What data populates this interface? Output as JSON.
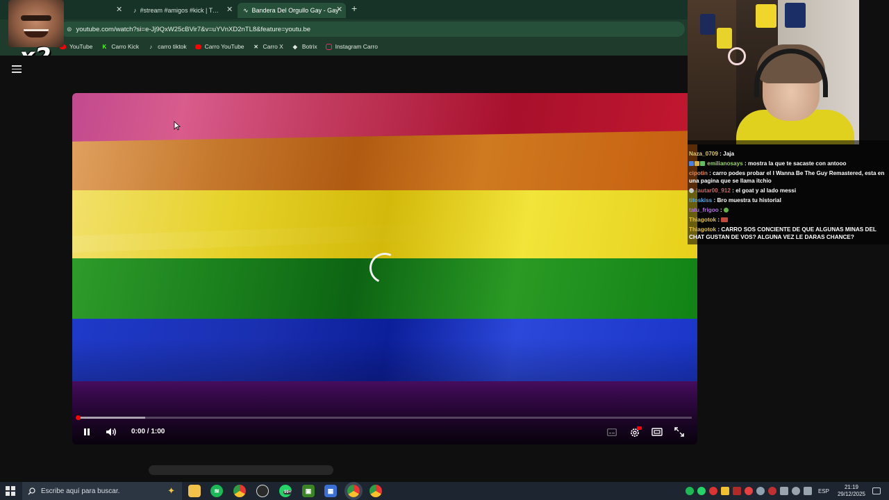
{
  "browser": {
    "tabs": [
      {
        "title": "#stream #amigos #kick | TikTok",
        "icon": "tiktok-icon",
        "active": false
      },
      {
        "title": "Bandera Del Orgullo Gay - Gay",
        "icon": "youtube-tab-icon",
        "active": true
      }
    ],
    "url": "youtube.com/watch?si=e-Jj9QxW25cBVir7&v=uYVnXD2nTL8&feature=youtu.be",
    "bookmarks": [
      {
        "label": "YouTube",
        "icon": "youtube-icon",
        "color": "#ff0000"
      },
      {
        "label": "Carro Kick",
        "icon": "kick-icon",
        "color": "#53fc18"
      },
      {
        "label": "carro tiktok",
        "icon": "tiktok-icon",
        "color": "#ffffff"
      },
      {
        "label": "Carro YouTube",
        "icon": "youtube-icon",
        "color": "#ff0000"
      },
      {
        "label": "Carro X",
        "icon": "x-icon",
        "color": "#ffffff"
      },
      {
        "label": "Botrix",
        "icon": "botrix-icon",
        "color": "#ffffff"
      },
      {
        "label": "Instagram Carro",
        "icon": "instagram-icon",
        "color": "#e1306c"
      }
    ]
  },
  "overlay": {
    "meme_text": "x2"
  },
  "player": {
    "time_display": "0:00 / 1:00",
    "played_fraction": 0.0,
    "buffered_fraction": 0.11,
    "state": "playing",
    "loading": true
  },
  "chat": {
    "messages": [
      {
        "user": "Naza_0709",
        "user_color": "#d8c870",
        "text": "Jaja"
      },
      {
        "user": "emilianosays",
        "user_color": "#9ad06a",
        "text": "mostra la que te sacaste con antooo"
      },
      {
        "user": "cipotin",
        "user_color": "#e08a58",
        "text": "carro podes probar el I Wanna Be The Guy Remastered, esta en una pagina que se llama itchio"
      },
      {
        "user": "lautar00_912",
        "user_color": "#c06a6a",
        "text": "el goat y al lado messi"
      },
      {
        "user": "titoskiss",
        "user_color": "#58a8e0",
        "text": "Bro muestra tu historial"
      },
      {
        "user": "tatu_frigoo",
        "user_color": "#b070e0",
        "text": ""
      },
      {
        "user": "Thiagotok",
        "user_color": "#e0c040",
        "text": ""
      },
      {
        "user": "Thiagotok",
        "user_color": "#e0c040",
        "text": "CARRO SOS CONCIENTE DE QUE ALGUNAS MINAS DEL CHAT GUSTAN DE VOS? ALGUNA VEZ LE DARAS CHANCE?"
      }
    ]
  },
  "taskbar": {
    "search_placeholder": "Escribe aquí para buscar.",
    "whatsapp_badge": "99+",
    "language": "ESP",
    "time": "21:19",
    "date": "29/12/2025"
  }
}
